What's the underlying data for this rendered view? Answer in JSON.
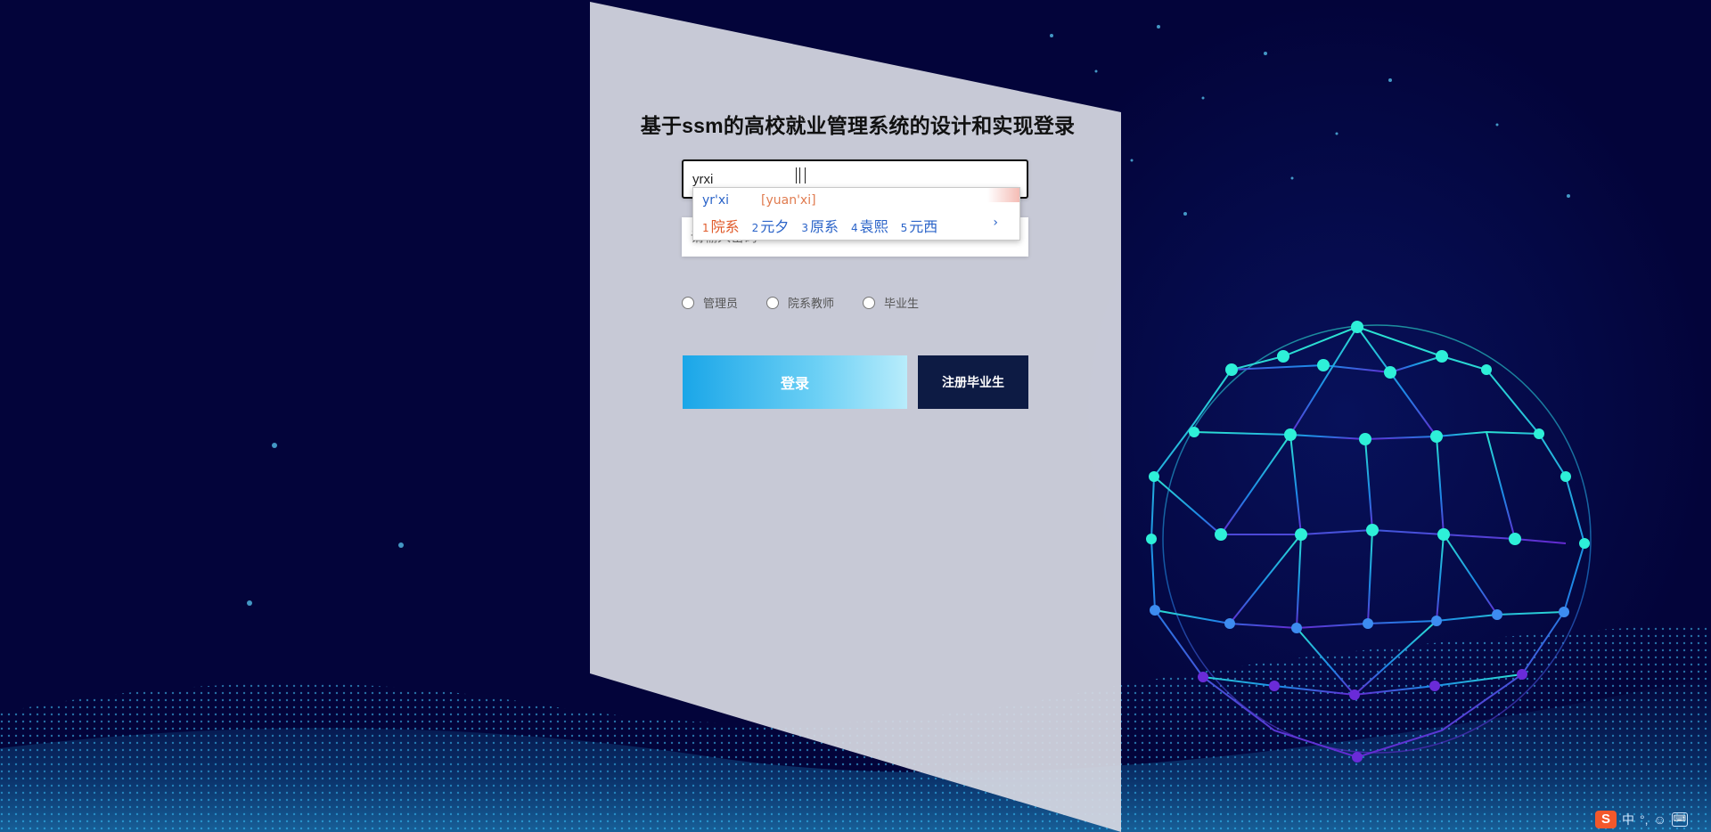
{
  "page": {
    "title": "基于ssm的高校就业管理系统的设计和实现登录"
  },
  "form": {
    "username_value": "yrxi",
    "password_placeholder": "请输入密码",
    "roles": [
      {
        "label": "管理员"
      },
      {
        "label": "院系教师"
      },
      {
        "label": "毕业生"
      }
    ],
    "login_label": "登录",
    "register_label": "注册毕业生"
  },
  "ime": {
    "pinyin": "yr'xi",
    "hint": "[yuan'xi]",
    "candidates": [
      {
        "num": "1",
        "text": "院系"
      },
      {
        "num": "2",
        "text": "元夕"
      },
      {
        "num": "3",
        "text": "原系"
      },
      {
        "num": "4",
        "text": "袁熙"
      },
      {
        "num": "5",
        "text": "元西"
      }
    ],
    "next_arrow": "›"
  },
  "tray": {
    "logo": "S",
    "mode": "中",
    "punct": "°,",
    "emoji_icon": "smiley-icon",
    "keyboard_icon": "keyboard-icon"
  },
  "colors": {
    "background": "#03043a",
    "login_button": "#1aa6e8",
    "register_button": "#0d1b44",
    "sogou": "#f3582b"
  }
}
